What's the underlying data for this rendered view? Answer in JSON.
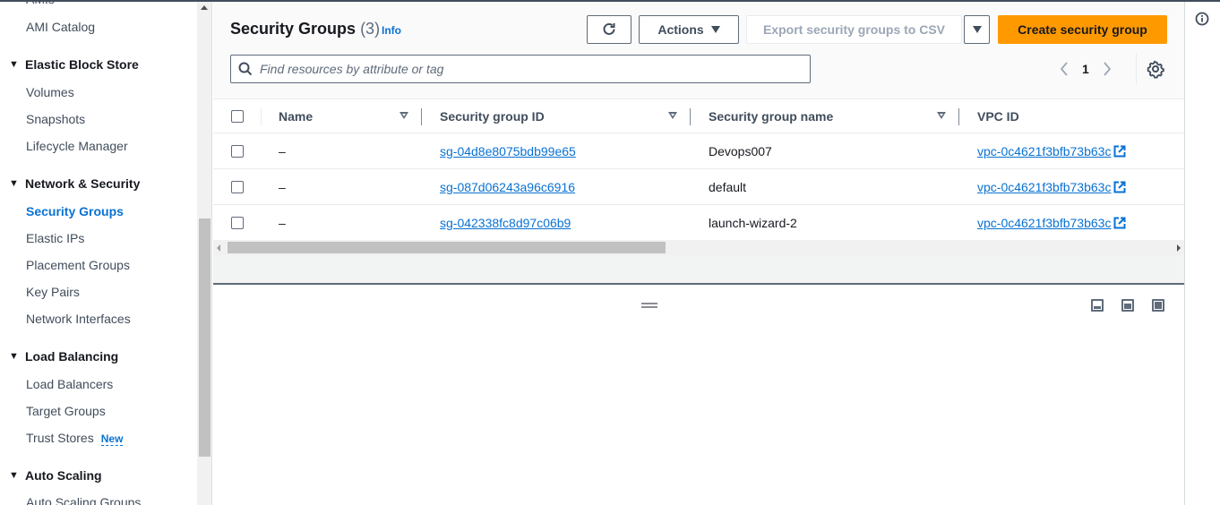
{
  "sidebar": {
    "partial_top_item": "AMIs",
    "items": [
      {
        "type": "item",
        "label": "AMI Catalog"
      },
      {
        "type": "section",
        "label": "Elastic Block Store"
      },
      {
        "type": "item",
        "label": "Volumes"
      },
      {
        "type": "item",
        "label": "Snapshots"
      },
      {
        "type": "item",
        "label": "Lifecycle Manager"
      },
      {
        "type": "section",
        "label": "Network & Security"
      },
      {
        "type": "item",
        "label": "Security Groups",
        "active": true
      },
      {
        "type": "item",
        "label": "Elastic IPs"
      },
      {
        "type": "item",
        "label": "Placement Groups"
      },
      {
        "type": "item",
        "label": "Key Pairs"
      },
      {
        "type": "item",
        "label": "Network Interfaces"
      },
      {
        "type": "section",
        "label": "Load Balancing"
      },
      {
        "type": "item",
        "label": "Load Balancers"
      },
      {
        "type": "item",
        "label": "Target Groups"
      },
      {
        "type": "item",
        "label": "Trust Stores",
        "badge": "New"
      },
      {
        "type": "section",
        "label": "Auto Scaling"
      },
      {
        "type": "item",
        "label": "Auto Scaling Groups"
      }
    ]
  },
  "header": {
    "title": "Security Groups",
    "count": "(3)",
    "info_label": "Info"
  },
  "toolbar": {
    "refresh_icon": "refresh-icon",
    "actions_label": "Actions",
    "export_label": "Export security groups to CSV",
    "create_label": "Create security group"
  },
  "search": {
    "placeholder": "Find resources by attribute or tag",
    "value": ""
  },
  "pagination": {
    "current_page": "1"
  },
  "table": {
    "columns": [
      "Name",
      "Security group ID",
      "Security group name",
      "VPC ID"
    ],
    "rows": [
      {
        "name": "–",
        "sg_id": "sg-04d8e8075bdb99e65",
        "sg_name": "Devops007",
        "vpc_id": "vpc-0c4621f3bfb73b63c"
      },
      {
        "name": "–",
        "sg_id": "sg-087d06243a96c6916",
        "sg_name": "default",
        "vpc_id": "vpc-0c4621f3bfb73b63c"
      },
      {
        "name": "–",
        "sg_id": "sg-042338fc8d97c06b9",
        "sg_name": "launch-wizard-2",
        "vpc_id": "vpc-0c4621f3bfb73b63c"
      }
    ]
  },
  "colors": {
    "primary_button": "#ff9900",
    "link": "#0972d3",
    "text": "#16191f"
  }
}
